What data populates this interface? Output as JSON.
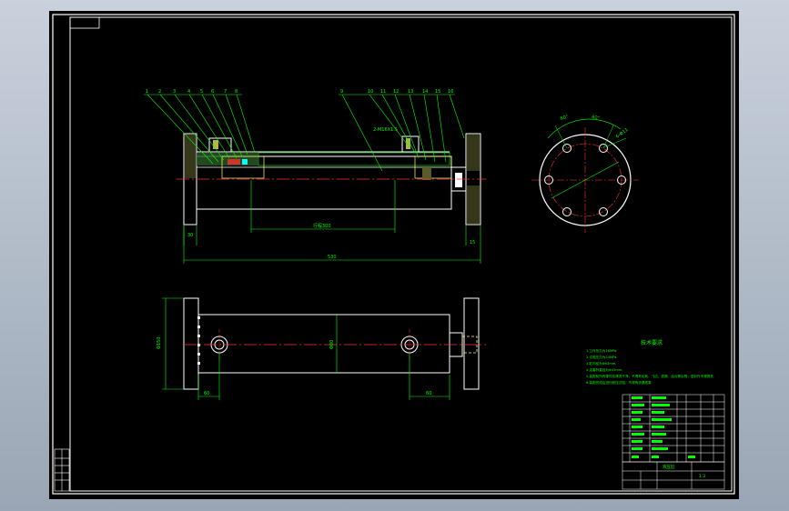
{
  "drawing": {
    "part_balloons_left": [
      "1",
      "2",
      "3",
      "4",
      "5",
      "6",
      "7",
      "8"
    ],
    "part_balloons_right": [
      "9",
      "10",
      "11",
      "12",
      "13",
      "14",
      "15",
      "16"
    ],
    "thread_callout": "2-M16X1.5",
    "dim_stroke": "行程300",
    "dim_overall_length": "530",
    "dim_flange_thk_left": "30",
    "dim_flange_thk_right": "15",
    "dim_body_height": "Φ80",
    "dim_flange_height": "Φ150",
    "dim_port_left": "60",
    "dim_port_right": "60",
    "dim_angle_1": "60°",
    "dim_angle_2": "60°",
    "dim_hole_pattern": "6-Φ11",
    "notes_title": "技术要求",
    "notes": [
      "1.工作压力为16MPa.",
      "2.试验压力为24MPa.",
      "3.缸内径为Φ63mm.",
      "4.活塞杆直径为Φ45mm.",
      "5.装配前所有零件应清洗干净，不得有毛刺、飞边、铁屑、油污等杂物，密封件不得损伤.",
      "6.装配完成后进行耐压试验，不得有渗漏现象."
    ],
    "title_block_name": "液压缸",
    "title_block_sheet": "1:2"
  },
  "colors": {
    "background": "#000000",
    "outline": "#ffffff",
    "dimension": "#00ff00",
    "centerline": "#ff3030",
    "section": "#ffff66",
    "accent": "#00ffff"
  }
}
